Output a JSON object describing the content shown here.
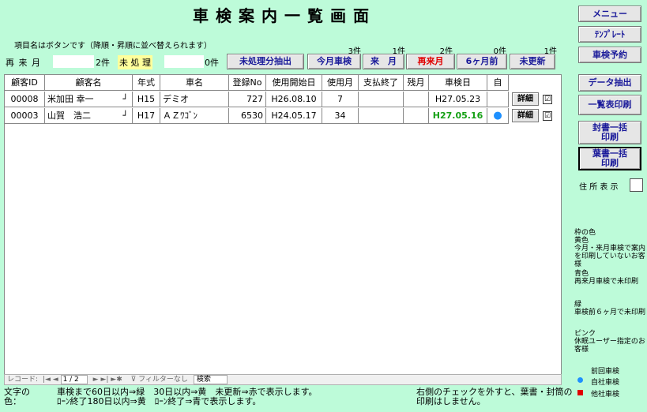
{
  "title": "車検案内一覧画面",
  "sort_hint": "項目名はボタンです（降順・昇順に並べ替えられます）",
  "counters": {
    "saiki_label": "再 来 月",
    "saiki_value": "2件",
    "mishori_label": "未 処 理",
    "mishori_value": "0件"
  },
  "filter_buttons": [
    {
      "label": "未処理分抽出",
      "count": ""
    },
    {
      "label": "今月車検",
      "count": "3件"
    },
    {
      "label": "来　月",
      "count": "1件"
    },
    {
      "label": "再来月",
      "count": "2件"
    },
    {
      "label": "6ヶ月前",
      "count": "0件"
    },
    {
      "label": "未更新",
      "count": "1件"
    }
  ],
  "table": {
    "headers": [
      "顧客ID",
      "顧客名",
      "年式",
      "車名",
      "登録No",
      "使用開始日",
      "使用月",
      "支払終了",
      "残月",
      "車検日",
      "自"
    ],
    "rows": [
      {
        "id": "00008",
        "name": "米加田 幸一",
        "year": "H15",
        "car": "デミオ",
        "reg": "727",
        "start": "H26.08.10",
        "months": "7",
        "pay_end": "",
        "remain": "",
        "shaken": "H27.05.23",
        "shaken_color": "#000000",
        "own": "",
        "detail": "詳細",
        "checked": "☑"
      },
      {
        "id": "00003",
        "name": "山賀　浩二",
        "year": "H17",
        "car": "ＡＺﾜｺﾞﾝ",
        "reg": "6530",
        "start": "H24.05.17",
        "months": "34",
        "pay_end": "",
        "remain": "",
        "shaken": "H27.05.16",
        "shaken_color": "#14a014",
        "own": "●",
        "detail": "詳細",
        "checked": "☑"
      }
    ]
  },
  "record_nav": {
    "label": "レコード:",
    "position": "1 / 2",
    "filter": "フィルターなし",
    "search": "検索"
  },
  "right_panel": {
    "menu": "メニュー",
    "template": "ﾃﾝﾌﾟﾚｰﾄ",
    "reserve": "車検予約",
    "extract": "データ抽出",
    "list_print": "一覧表印刷",
    "envelope_print": "封書一括\n印刷",
    "postcard_print": "葉書一括\n印刷",
    "address_label": "住 所 表 示"
  },
  "legend": {
    "frame_color": "枠の色",
    "yellow": "黄色\n今月・来月車検で案内を印刷していないお客様",
    "blue": "青色\n再来月車検で未印刷",
    "green": "緑\n車検前６ヶ月で未印刷",
    "pink": "ピンク\n休眠ユーザー指定のお客様",
    "prev_title": "前回車検",
    "own_car": "自社車検",
    "other_car": "他社車検",
    "own_color": "#1e90ff",
    "other_color": "#e00000"
  },
  "footer": {
    "color_label": "文字の\n色：",
    "rule1": "車検まで60日以内⇒緑　30日以内⇒黄　未更新⇒赤で表示します。",
    "rule2": "ﾛｰﾝ終了180日以内⇒黄　ﾛｰﾝ終了⇒青で表示します。",
    "note": "右側のチェックを外すと、葉書・封筒の印刷はしません。"
  }
}
